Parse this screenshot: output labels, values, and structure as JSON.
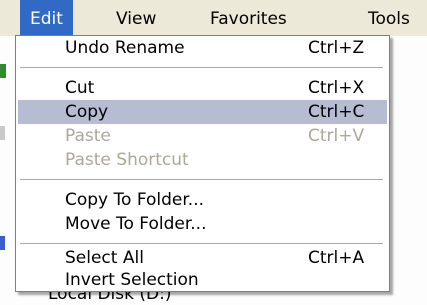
{
  "menubar": {
    "items": [
      {
        "label": "Edit"
      },
      {
        "label": "View"
      },
      {
        "label": "Favorites"
      },
      {
        "label": "Tools"
      }
    ]
  },
  "edit_menu": {
    "items": [
      {
        "label": "Undo Rename",
        "shortcut": "Ctrl+Z",
        "state": "normal"
      },
      {
        "label": "Cut",
        "shortcut": "Ctrl+X",
        "state": "normal"
      },
      {
        "label": "Copy",
        "shortcut": "Ctrl+C",
        "state": "highlighted"
      },
      {
        "label": "Paste",
        "shortcut": "Ctrl+V",
        "state": "disabled"
      },
      {
        "label": "Paste Shortcut",
        "shortcut": "",
        "state": "disabled"
      },
      {
        "label": "Copy To Folder...",
        "shortcut": "",
        "state": "normal"
      },
      {
        "label": "Move To Folder...",
        "shortcut": "",
        "state": "normal"
      },
      {
        "label": "Select All",
        "shortcut": "Ctrl+A",
        "state": "normal"
      },
      {
        "label": "Invert Selection",
        "shortcut": "",
        "state": "normal"
      }
    ]
  },
  "background": {
    "bottom_text": "Local Disk (D:)"
  },
  "colors": {
    "menubar_bg": "#ece9d8",
    "active_menu_bg": "#316ac5",
    "highlight_bg": "#b6bdd2",
    "disabled_text": "#aca899"
  }
}
